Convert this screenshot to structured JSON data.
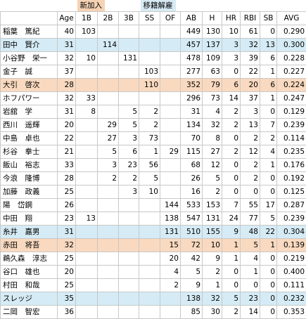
{
  "legend": {
    "new_label": "新加入",
    "move_label": "移籍解雇",
    "new_color": "#f9d9bf",
    "move_color": "#d5ebf5"
  },
  "headers": [
    "",
    "Age",
    "1B",
    "2B",
    "3B",
    "SS",
    "OF",
    "AB",
    "H",
    "HR",
    "RBI",
    "SB",
    "AVG"
  ],
  "rows": [
    {
      "status": "",
      "cells": [
        "稲葉　篤紀",
        "40",
        "103",
        "",
        "",
        "",
        "",
        "449",
        "130",
        "10",
        "61",
        "0",
        "0.290"
      ]
    },
    {
      "status": "move",
      "cells": [
        "田中　賢介",
        "31",
        "",
        "114",
        "",
        "",
        "",
        "457",
        "137",
        "3",
        "32",
        "13",
        "0.300"
      ]
    },
    {
      "status": "",
      "cells": [
        "小谷野　栄一",
        "32",
        "10",
        "",
        "131",
        "",
        "",
        "478",
        "109",
        "3",
        "39",
        "6",
        "0.228"
      ]
    },
    {
      "status": "",
      "cells": [
        "金子　誠",
        "37",
        "",
        "",
        "",
        "103",
        "",
        "277",
        "63",
        "0",
        "22",
        "1",
        "0.227"
      ]
    },
    {
      "status": "new",
      "cells": [
        "大引　啓次",
        "28",
        "",
        "",
        "",
        "110",
        "",
        "352",
        "79",
        "6",
        "20",
        "6",
        "0.224"
      ]
    },
    {
      "status": "",
      "cells": [
        "ホフパワー",
        "32",
        "33",
        "",
        "",
        "",
        "",
        "296",
        "73",
        "14",
        "37",
        "1",
        "0.247"
      ]
    },
    {
      "status": "",
      "cells": [
        "岩舘　学",
        "31",
        "8",
        "",
        "5",
        "2",
        "",
        "31",
        "4",
        "2",
        "3",
        "0",
        "0.129"
      ]
    },
    {
      "status": "",
      "cells": [
        "西川　遥輝",
        "20",
        "",
        "29",
        "5",
        "2",
        "",
        "134",
        "32",
        "2",
        "13",
        "7",
        "0.239"
      ]
    },
    {
      "status": "",
      "cells": [
        "中島　卓也",
        "22",
        "",
        "27",
        "3",
        "73",
        "",
        "70",
        "8",
        "0",
        "2",
        "2",
        "0.114"
      ]
    },
    {
      "status": "",
      "cells": [
        "杉谷　拳士",
        "21",
        "",
        "5",
        "6",
        "1",
        "29",
        "115",
        "27",
        "2",
        "12",
        "4",
        "0.235"
      ]
    },
    {
      "status": "",
      "cells": [
        "飯山　裕志",
        "33",
        "",
        "3",
        "23",
        "56",
        "",
        "68",
        "12",
        "0",
        "2",
        "1",
        "0.176"
      ]
    },
    {
      "status": "",
      "cells": [
        "今浪　隆博",
        "28",
        "",
        "2",
        "2",
        "5",
        "",
        "26",
        "5",
        "0",
        "2",
        "0",
        "0.192"
      ]
    },
    {
      "status": "",
      "cells": [
        "加藤　政義",
        "25",
        "",
        "",
        "3",
        "10",
        "",
        "16",
        "2",
        "0",
        "0",
        "0",
        "0.125"
      ]
    },
    {
      "status": "",
      "cells": [
        "陽　岱鋼",
        "26",
        "",
        "",
        "",
        "",
        "144",
        "533",
        "153",
        "7",
        "55",
        "17",
        "0.287"
      ]
    },
    {
      "status": "",
      "cells": [
        "中田　翔",
        "23",
        "13",
        "",
        "",
        "",
        "138",
        "547",
        "131",
        "24",
        "77",
        "5",
        "0.239"
      ]
    },
    {
      "status": "move",
      "cells": [
        "糸井　嘉男",
        "31",
        "",
        "",
        "",
        "",
        "131",
        "510",
        "155",
        "9",
        "48",
        "22",
        "0.304"
      ]
    },
    {
      "status": "new",
      "cells": [
        "赤田　将吾",
        "32",
        "",
        "",
        "",
        "",
        "15",
        "72",
        "10",
        "1",
        "5",
        "1",
        "0.139"
      ]
    },
    {
      "status": "",
      "cells": [
        "鵜久森　淳志",
        "25",
        "",
        "",
        "",
        "",
        "20",
        "42",
        "9",
        "1",
        "4",
        "0",
        "0.219"
      ]
    },
    {
      "status": "",
      "cells": [
        "谷口　雄也",
        "20",
        "",
        "",
        "",
        "",
        "4",
        "5",
        "2",
        "0",
        "1",
        "0",
        "0.400"
      ]
    },
    {
      "status": "",
      "cells": [
        "村田　和哉",
        "25",
        "",
        "",
        "",
        "",
        "2",
        "9",
        "1",
        "0",
        "0",
        "0",
        "0.111"
      ]
    },
    {
      "status": "move",
      "cells": [
        "スレッジ",
        "35",
        "",
        "",
        "",
        "",
        "",
        "138",
        "32",
        "5",
        "23",
        "0",
        "0.232"
      ]
    },
    {
      "status": "",
      "cells": [
        "二岡　智宏",
        "36",
        "",
        "",
        "",
        "",
        "",
        "85",
        "30",
        "2",
        "14",
        "0",
        "0.353"
      ]
    }
  ]
}
